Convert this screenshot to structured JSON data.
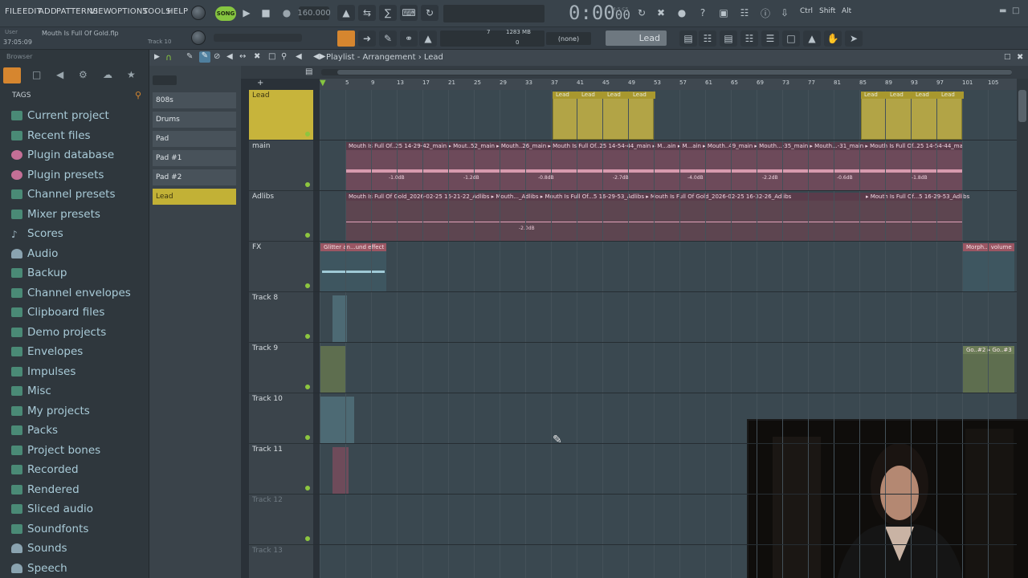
{
  "menu": [
    "FILE",
    "EDIT",
    "ADD",
    "PATTERNS",
    "VIEW",
    "OPTIONS",
    "TOOLS",
    "HELP"
  ],
  "transport": {
    "song_label": "SONG",
    "tempo": "160.000",
    "time": "0:00",
    "time_frac": "00",
    "time_unit": "M:S:CS"
  },
  "modifiers": [
    "Ctrl",
    "Shift",
    "Alt"
  ],
  "hint": {
    "user": "User",
    "file": "Mouth Is Full Of Gold.flp",
    "time": "37:05:09",
    "track": "Track 10"
  },
  "meters": {
    "cpu": "7",
    "mem": "1283 MB",
    "cpu_zero": "0"
  },
  "selectors": {
    "none": "(none)",
    "channel": "Lead"
  },
  "browser": {
    "title": "Browser",
    "tags_label": "TAGS",
    "items": [
      {
        "label": "Current project",
        "icon": "folder-icon"
      },
      {
        "label": "Recent files",
        "icon": "folder-icon"
      },
      {
        "label": "Plugin database",
        "icon": "plugin-icon"
      },
      {
        "label": "Plugin presets",
        "icon": "plugin-icon"
      },
      {
        "label": "Channel presets",
        "icon": "folder-icon"
      },
      {
        "label": "Mixer presets",
        "icon": "folder-icon"
      },
      {
        "label": "Scores",
        "icon": "note-icon"
      },
      {
        "label": "Audio",
        "icon": "person-icon"
      },
      {
        "label": "Backup",
        "icon": "folder-icon"
      },
      {
        "label": "Channel envelopes",
        "icon": "folder-icon"
      },
      {
        "label": "Clipboard files",
        "icon": "folder-icon"
      },
      {
        "label": "Demo projects",
        "icon": "folder-icon"
      },
      {
        "label": "Envelopes",
        "icon": "folder-icon"
      },
      {
        "label": "Impulses",
        "icon": "folder-icon"
      },
      {
        "label": "Misc",
        "icon": "folder-icon"
      },
      {
        "label": "My projects",
        "icon": "folder-icon"
      },
      {
        "label": "Packs",
        "icon": "folder-icon"
      },
      {
        "label": "Project bones",
        "icon": "folder-icon"
      },
      {
        "label": "Recorded",
        "icon": "folder-icon"
      },
      {
        "label": "Rendered",
        "icon": "folder-icon"
      },
      {
        "label": "Sliced audio",
        "icon": "folder-icon"
      },
      {
        "label": "Soundfonts",
        "icon": "folder-icon"
      },
      {
        "label": "Sounds",
        "icon": "person-icon"
      },
      {
        "label": "Speech",
        "icon": "person-icon"
      }
    ]
  },
  "channels": [
    "808s",
    "Drums",
    "Pad",
    "Pad #1",
    "Pad #2",
    "Lead"
  ],
  "playlist": {
    "title": "Playlist - Arrangement",
    "current": "Lead",
    "ruler": [
      "5",
      "9",
      "13",
      "17",
      "21",
      "25",
      "29",
      "33",
      "37",
      "41",
      "45",
      "49",
      "53",
      "57",
      "61",
      "65",
      "69",
      "73",
      "77",
      "81",
      "85",
      "89",
      "93",
      "97",
      "101",
      "105"
    ],
    "tracks": [
      "Lead",
      "main",
      "Adlibs",
      "FX",
      "Track 8",
      "Track 9",
      "Track 10",
      "Track 11",
      "Track 12",
      "Track 13"
    ],
    "lead_clips": [
      "Lead",
      "Lead",
      "Lead",
      "Lead",
      "Lead",
      "Lead",
      "Lead",
      "Lead"
    ],
    "main_clip": "Mouth Is Full Of..25 14-29-42_main ▸ Mout..52_main ▸ Mouth..26_main ▸ Mouth Is Full Of..25 14-54-44_main ▸ M...ain ▸ M...ain ▸ Mouth..49_main ▸ Mouth...-35_main ▸ Mouth...-31_main ▸ Mouth Is Full Of..25 14-54-44_main",
    "main_gains": [
      "-1.0dB",
      "-1.2dB",
      "-0.8dB",
      "-2.7dB",
      "-4.0dB",
      "-2.2dB",
      "-0.6dB",
      "-1.8dB"
    ],
    "adlibs_clip": "Mouth Is Full Of Gold_2026-02-25 16-21-22_Adlibs ▸ Mouth..._Adlibs ▸ Mouth Is Full Of...5 16-29-53_Adlibs ▸ Mouth Is Full Of Gold_2026-02-25 16-32-26_Adlibs",
    "adlibs_clip2": "▸ Mouth Is Full Of...5 16-29-53_Adlibs",
    "adlibs_gain": "-2.0dB",
    "fx_clip": "Glitter an...und effect",
    "fx_clip_right": "Morph..l volume",
    "t9_clip_right": "Go..#2 ▸ Go..#3"
  },
  "colors": {
    "lead": "#c2b136",
    "main": "#b35a85",
    "accent": "#86c540"
  }
}
